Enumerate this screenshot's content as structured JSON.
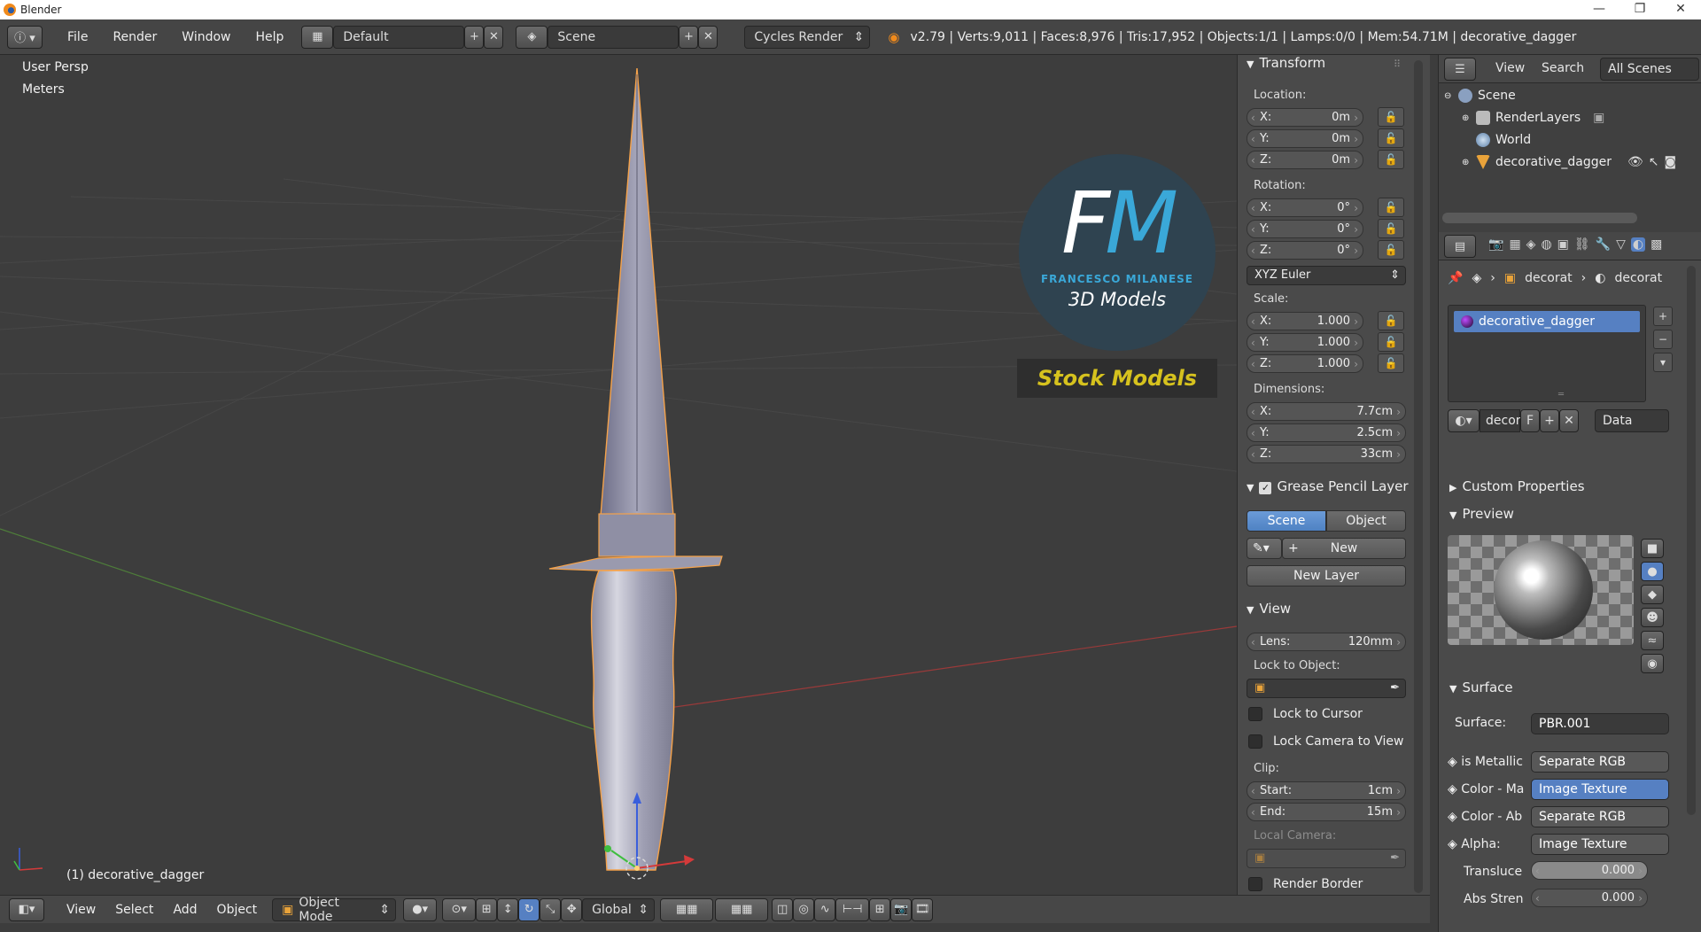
{
  "window": {
    "title": "Blender",
    "controls": [
      "—",
      "❐",
      "✕"
    ]
  },
  "menu": {
    "items": [
      "File",
      "Render",
      "Window",
      "Help"
    ]
  },
  "layout": {
    "name": "Default"
  },
  "scene": {
    "name": "Scene"
  },
  "engine": {
    "name": "Cycles Render"
  },
  "stats": "v2.79 | Verts:9,011 | Faces:8,976 | Tris:17,952 | Objects:1/1 | Lamps:0/0 | Mem:54.71M | decorative_dagger",
  "viewport": {
    "view_name": "User Persp",
    "units": "Meters",
    "object_label": "(1) decorative_dagger",
    "watermark": {
      "brand": "FM",
      "maker": "FRANCESCO MILANESE",
      "tagline": "3D Models",
      "banner": "Stock Models"
    }
  },
  "npanel": {
    "transform": {
      "title": "Transform",
      "location_label": "Location:",
      "location": [
        {
          "axis": "X:",
          "value": "0m"
        },
        {
          "axis": "Y:",
          "value": "0m"
        },
        {
          "axis": "Z:",
          "value": "0m"
        }
      ],
      "rotation_label": "Rotation:",
      "rotation": [
        {
          "axis": "X:",
          "value": "0°"
        },
        {
          "axis": "Y:",
          "value": "0°"
        },
        {
          "axis": "Z:",
          "value": "0°"
        }
      ],
      "rotation_mode": "XYZ Euler",
      "scale_label": "Scale:",
      "scale": [
        {
          "axis": "X:",
          "value": "1.000"
        },
        {
          "axis": "Y:",
          "value": "1.000"
        },
        {
          "axis": "Z:",
          "value": "1.000"
        }
      ],
      "dimensions_label": "Dimensions:",
      "dimensions": [
        {
          "axis": "X:",
          "value": "7.7cm"
        },
        {
          "axis": "Y:",
          "value": "2.5cm"
        },
        {
          "axis": "Z:",
          "value": "33cm"
        }
      ]
    },
    "grease_pencil": {
      "title": "Grease Pencil Layer",
      "tab_scene": "Scene",
      "tab_object": "Object",
      "new_label": "New",
      "new_layer_label": "New Layer"
    },
    "view": {
      "title": "View",
      "lens_label": "Lens:",
      "lens_value": "120mm",
      "lock_object_label": "Lock to Object:",
      "lock_cursor": "Lock to Cursor",
      "lock_camera": "Lock Camera to View",
      "clip_label": "Clip:",
      "clip_start_label": "Start:",
      "clip_start": "1cm",
      "clip_end_label": "End:",
      "clip_end": "15m",
      "local_camera_label": "Local Camera:",
      "render_border": "Render Border"
    }
  },
  "outliner": {
    "menu": [
      "View",
      "Search"
    ],
    "filter": "All Scenes",
    "items": [
      "Scene",
      "RenderLayers",
      "World",
      "decorative_dagger"
    ]
  },
  "properties": {
    "breadcrumb": [
      "decorat",
      "decorat"
    ],
    "material_slot": "decorative_dagger",
    "material_name": "decor",
    "fake_user": "F",
    "link_mode": "Data",
    "custom_props_title": "Custom Properties",
    "preview_title": "Preview",
    "surface_title": "Surface",
    "surface_label": "Surface:",
    "surface_value": "PBR.001",
    "inputs": [
      {
        "label": "is Metallic",
        "value": "Separate RGB",
        "highlight": false
      },
      {
        "label": "Color - Ma",
        "value": "Image Texture",
        "highlight": true
      },
      {
        "label": "Color - Ab",
        "value": "Separate RGB",
        "highlight": false
      },
      {
        "label": "Alpha:",
        "value": "Image Texture",
        "highlight": false
      }
    ],
    "translucency_label": "Transluce",
    "translucency_value": "0.000",
    "abs_label": "Abs Stren",
    "abs_value": "0.000"
  },
  "bottombar": {
    "menu": [
      "View",
      "Select",
      "Add",
      "Object"
    ],
    "mode": "Object Mode",
    "orientation": "Global"
  },
  "colors": {
    "accent": "#5680c2",
    "viewport_bg": "#3d3d3d",
    "panel_bg": "#4a4a4a",
    "selection_orange": "#f5a24a",
    "banner_yellow": "#d6c21e",
    "brand_cyan": "#3aa8d8"
  }
}
